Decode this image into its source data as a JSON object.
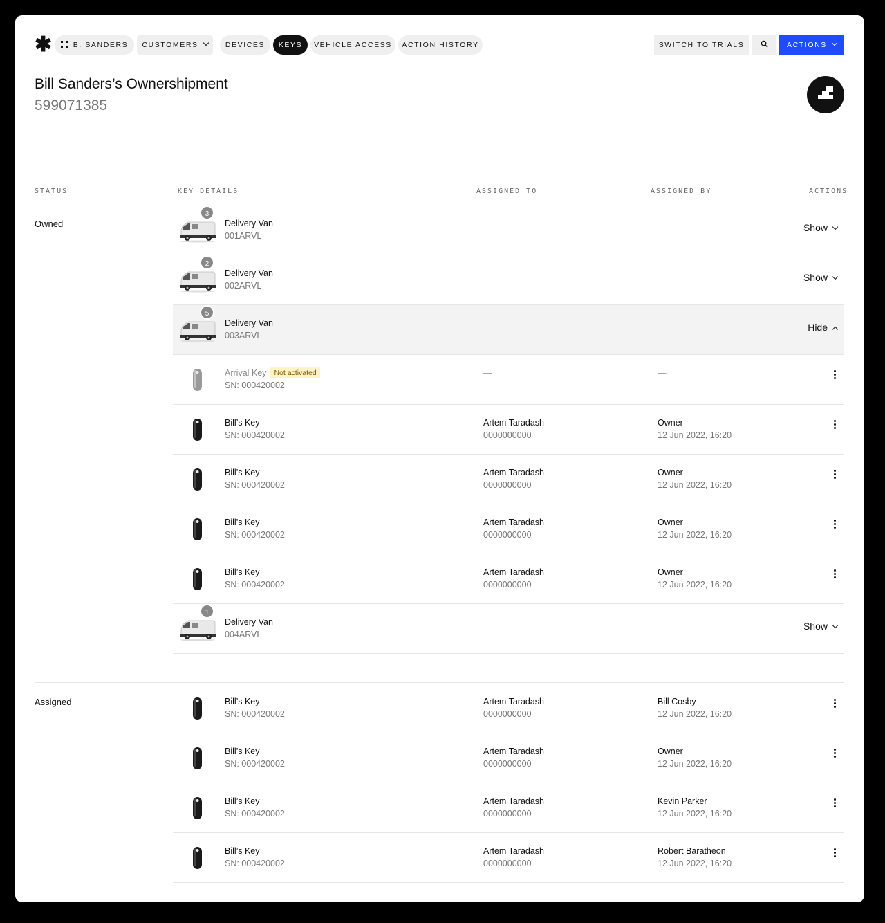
{
  "nav": {
    "user_label": "B. SANDERS",
    "customers_label": "CUSTOMERS",
    "tabs": [
      {
        "label": "DEVICES",
        "active": false
      },
      {
        "label": "KEYS",
        "active": true
      },
      {
        "label": "VEHICLE ACCESS",
        "active": false
      },
      {
        "label": "ACTION HISTORY",
        "active": false
      }
    ],
    "switch_label": "SWITCH TO TRIALS",
    "actions_label": "ACTIONS",
    "accent_color": "#1f4cff"
  },
  "header": {
    "title": "Bill Sanders’s Ownershipment",
    "subtitle": "599071385"
  },
  "table": {
    "columns": [
      "STATUS",
      "KEY DETAILS",
      "ASSIGNED TO",
      "ASSIGNED BY",
      "ACTIONS"
    ],
    "owned": {
      "status": "Owned",
      "vans": [
        {
          "name": "Delivery Van",
          "code": "001ARVL",
          "count": "3",
          "toggle": "Show"
        },
        {
          "name": "Delivery Van",
          "code": "002ARVL",
          "count": "2",
          "toggle": "Show"
        },
        {
          "name": "Delivery Van",
          "code": "003ARVL",
          "count": "5",
          "toggle": "Hide"
        },
        {
          "name": "Delivery Van",
          "code": "004ARVL",
          "count": "1",
          "toggle": "Show"
        }
      ],
      "expanded_keys": [
        {
          "name": "Arrival Key",
          "tag": "Not activated",
          "sn": "SN: 000420002",
          "to_name": "—",
          "to_phone": "",
          "by_name": "—",
          "by_date": ""
        },
        {
          "name": "Bill’s Key",
          "sn": "SN: 000420002",
          "to_name": "Artem Taradash",
          "to_phone": "0000000000",
          "by_name": "Owner",
          "by_date": "12 Jun 2022, 16:20"
        },
        {
          "name": "Bill’s Key",
          "sn": "SN: 000420002",
          "to_name": "Artem Taradash",
          "to_phone": "0000000000",
          "by_name": "Owner",
          "by_date": "12 Jun 2022, 16:20"
        },
        {
          "name": "Bill’s Key",
          "sn": "SN: 000420002",
          "to_name": "Artem Taradash",
          "to_phone": "0000000000",
          "by_name": "Owner",
          "by_date": "12 Jun 2022, 16:20"
        },
        {
          "name": "Bill’s Key",
          "sn": "SN: 000420002",
          "to_name": "Artem Taradash",
          "to_phone": "0000000000",
          "by_name": "Owner",
          "by_date": "12 Jun 2022, 16:20"
        }
      ]
    },
    "assigned": {
      "status": "Assigned",
      "keys": [
        {
          "name": "Bill’s Key",
          "sn": "SN: 000420002",
          "to_name": "Artem Taradash",
          "to_phone": "0000000000",
          "by_name": "Bill Cosby",
          "by_date": "12 Jun 2022, 16:20"
        },
        {
          "name": "Bill’s Key",
          "sn": "SN: 000420002",
          "to_name": "Artem Taradash",
          "to_phone": "0000000000",
          "by_name": "Owner",
          "by_date": "12 Jun 2022, 16:20"
        },
        {
          "name": "Bill’s Key",
          "sn": "SN: 000420002",
          "to_name": "Artem Taradash",
          "to_phone": "0000000000",
          "by_name": "Kevin Parker",
          "by_date": "12 Jun 2022, 16:20"
        },
        {
          "name": "Bill’s Key",
          "sn": "SN: 000420002",
          "to_name": "Artem Taradash",
          "to_phone": "0000000000",
          "by_name": "Robert Baratheon",
          "by_date": "12 Jun 2022, 16:20"
        }
      ]
    }
  }
}
